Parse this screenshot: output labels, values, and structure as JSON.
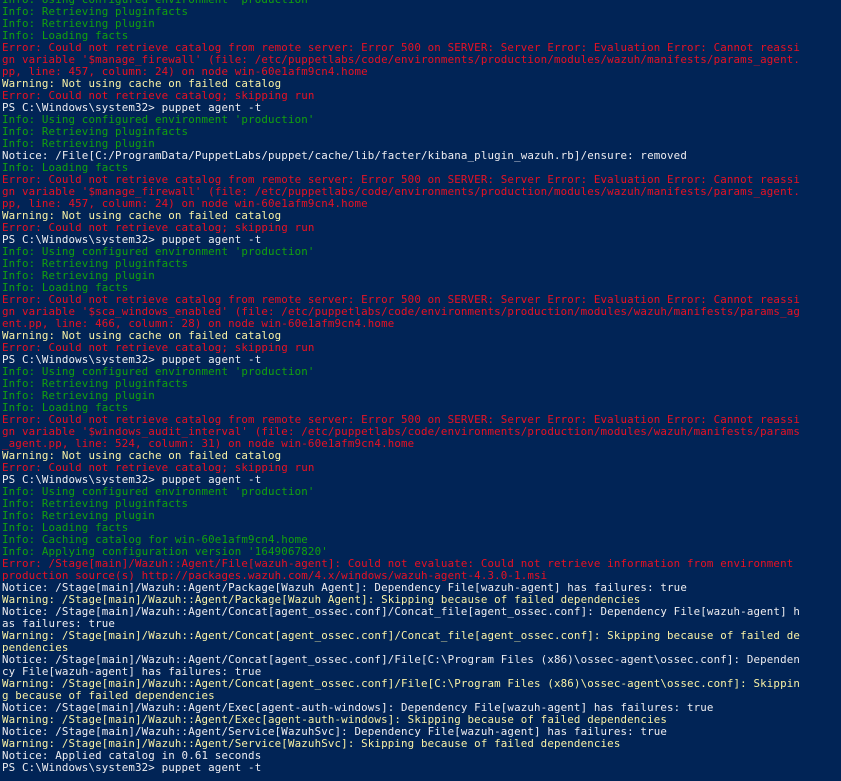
{
  "colors": {
    "background": "#012456",
    "info": "#13a10e",
    "error": "#e81123",
    "warning": "#f9f1a5",
    "notice": "#eeedf0",
    "prompt": "#eeedf0"
  },
  "lines": [
    {
      "type": "info",
      "text": "Info: Using configured environment 'production'"
    },
    {
      "type": "info",
      "text": "Info: Retrieving pluginfacts"
    },
    {
      "type": "info",
      "text": "Info: Retrieving plugin"
    },
    {
      "type": "info",
      "text": "Info: Loading facts"
    },
    {
      "type": "error",
      "text": "Error: Could not retrieve catalog from remote server: Error 500 on SERVER: Server Error: Evaluation Error: Cannot reassi"
    },
    {
      "type": "error",
      "text": "gn variable '$manage_firewall' (file: /etc/puppetlabs/code/environments/production/modules/wazuh/manifests/params_agent."
    },
    {
      "type": "error",
      "text": "pp, line: 457, column: 24) on node win-60e1afm9cn4.home"
    },
    {
      "type": "warning",
      "text": "Warning: Not using cache on failed catalog"
    },
    {
      "type": "error",
      "text": "Error: Could not retrieve catalog; skipping run"
    },
    {
      "type": "prompt",
      "text": "PS C:\\Windows\\system32> puppet agent -t"
    },
    {
      "type": "info",
      "text": "Info: Using configured environment 'production'"
    },
    {
      "type": "info",
      "text": "Info: Retrieving pluginfacts"
    },
    {
      "type": "info",
      "text": "Info: Retrieving plugin"
    },
    {
      "type": "notice",
      "text": "Notice: /File[C:/ProgramData/PuppetLabs/puppet/cache/lib/facter/kibana_plugin_wazuh.rb]/ensure: removed"
    },
    {
      "type": "info",
      "text": "Info: Loading facts"
    },
    {
      "type": "error",
      "text": "Error: Could not retrieve catalog from remote server: Error 500 on SERVER: Server Error: Evaluation Error: Cannot reassi"
    },
    {
      "type": "error",
      "text": "gn variable '$manage_firewall' (file: /etc/puppetlabs/code/environments/production/modules/wazuh/manifests/params_agent."
    },
    {
      "type": "error",
      "text": "pp, line: 457, column: 24) on node win-60e1afm9cn4.home"
    },
    {
      "type": "warning",
      "text": "Warning: Not using cache on failed catalog"
    },
    {
      "type": "error",
      "text": "Error: Could not retrieve catalog; skipping run"
    },
    {
      "type": "prompt",
      "text": "PS C:\\Windows\\system32> puppet agent -t"
    },
    {
      "type": "info",
      "text": "Info: Using configured environment 'production'"
    },
    {
      "type": "info",
      "text": "Info: Retrieving pluginfacts"
    },
    {
      "type": "info",
      "text": "Info: Retrieving plugin"
    },
    {
      "type": "info",
      "text": "Info: Loading facts"
    },
    {
      "type": "error",
      "text": "Error: Could not retrieve catalog from remote server: Error 500 on SERVER: Server Error: Evaluation Error: Cannot reassi"
    },
    {
      "type": "error",
      "text": "gn variable '$sca_windows_enabled' (file: /etc/puppetlabs/code/environments/production/modules/wazuh/manifests/params_ag"
    },
    {
      "type": "error",
      "text": "ent.pp, line: 466, column: 28) on node win-60e1afm9cn4.home"
    },
    {
      "type": "warning",
      "text": "Warning: Not using cache on failed catalog"
    },
    {
      "type": "error",
      "text": "Error: Could not retrieve catalog; skipping run"
    },
    {
      "type": "prompt",
      "text": "PS C:\\Windows\\system32> puppet agent -t"
    },
    {
      "type": "info",
      "text": "Info: Using configured environment 'production'"
    },
    {
      "type": "info",
      "text": "Info: Retrieving pluginfacts"
    },
    {
      "type": "info",
      "text": "Info: Retrieving plugin"
    },
    {
      "type": "info",
      "text": "Info: Loading facts"
    },
    {
      "type": "error",
      "text": "Error: Could not retrieve catalog from remote server: Error 500 on SERVER: Server Error: Evaluation Error: Cannot reassi"
    },
    {
      "type": "error",
      "text": "gn variable '$windows_audit_interval' (file: /etc/puppetlabs/code/environments/production/modules/wazuh/manifests/params"
    },
    {
      "type": "error",
      "text": "_agent.pp, line: 524, column: 31) on node win-60e1afm9cn4.home"
    },
    {
      "type": "warning",
      "text": "Warning: Not using cache on failed catalog"
    },
    {
      "type": "error",
      "text": "Error: Could not retrieve catalog; skipping run"
    },
    {
      "type": "prompt",
      "text": "PS C:\\Windows\\system32> puppet agent -t"
    },
    {
      "type": "info",
      "text": "Info: Using configured environment 'production'"
    },
    {
      "type": "info",
      "text": "Info: Retrieving pluginfacts"
    },
    {
      "type": "info",
      "text": "Info: Retrieving plugin"
    },
    {
      "type": "info",
      "text": "Info: Loading facts"
    },
    {
      "type": "info",
      "text": "Info: Caching catalog for win-60e1afm9cn4.home"
    },
    {
      "type": "info",
      "text": "Info: Applying configuration version '1649067820'"
    },
    {
      "type": "error",
      "text": "Error: /Stage[main]/Wazuh::Agent/File[wazuh-agent]: Could not evaluate: Could not retrieve information from environment"
    },
    {
      "type": "error",
      "text": "production source(s) http://packages.wazuh.com/4.x/windows/wazuh-agent-4.3.0-1.msi"
    },
    {
      "type": "notice",
      "text": "Notice: /Stage[main]/Wazuh::Agent/Package[Wazuh Agent]: Dependency File[wazuh-agent] has failures: true"
    },
    {
      "type": "warning",
      "text": "Warning: /Stage[main]/Wazuh::Agent/Package[Wazuh Agent]: Skipping because of failed dependencies"
    },
    {
      "type": "notice",
      "text": "Notice: /Stage[main]/Wazuh::Agent/Concat[agent_ossec.conf]/Concat_file[agent_ossec.conf]: Dependency File[wazuh-agent] h"
    },
    {
      "type": "notice",
      "text": "as failures: true"
    },
    {
      "type": "warning",
      "text": "Warning: /Stage[main]/Wazuh::Agent/Concat[agent_ossec.conf]/Concat_file[agent_ossec.conf]: Skipping because of failed de"
    },
    {
      "type": "warning",
      "text": "pendencies"
    },
    {
      "type": "notice",
      "text": "Notice: /Stage[main]/Wazuh::Agent/Concat[agent_ossec.conf]/File[C:\\Program Files (x86)\\ossec-agent\\ossec.conf]: Dependen"
    },
    {
      "type": "notice",
      "text": "cy File[wazuh-agent] has failures: true"
    },
    {
      "type": "warning",
      "text": "Warning: /Stage[main]/Wazuh::Agent/Concat[agent_ossec.conf]/File[C:\\Program Files (x86)\\ossec-agent\\ossec.conf]: Skippin"
    },
    {
      "type": "warning",
      "text": "g because of failed dependencies"
    },
    {
      "type": "notice",
      "text": "Notice: /Stage[main]/Wazuh::Agent/Exec[agent-auth-windows]: Dependency File[wazuh-agent] has failures: true"
    },
    {
      "type": "warning",
      "text": "Warning: /Stage[main]/Wazuh::Agent/Exec[agent-auth-windows]: Skipping because of failed dependencies"
    },
    {
      "type": "notice",
      "text": "Notice: /Stage[main]/Wazuh::Agent/Service[WazuhSvc]: Dependency File[wazuh-agent] has failures: true"
    },
    {
      "type": "warning",
      "text": "Warning: /Stage[main]/Wazuh::Agent/Service[WazuhSvc]: Skipping because of failed dependencies"
    },
    {
      "type": "notice",
      "text": "Notice: Applied catalog in 0.61 seconds"
    },
    {
      "type": "prompt",
      "text": "PS C:\\Windows\\system32> puppet agent -t"
    }
  ]
}
